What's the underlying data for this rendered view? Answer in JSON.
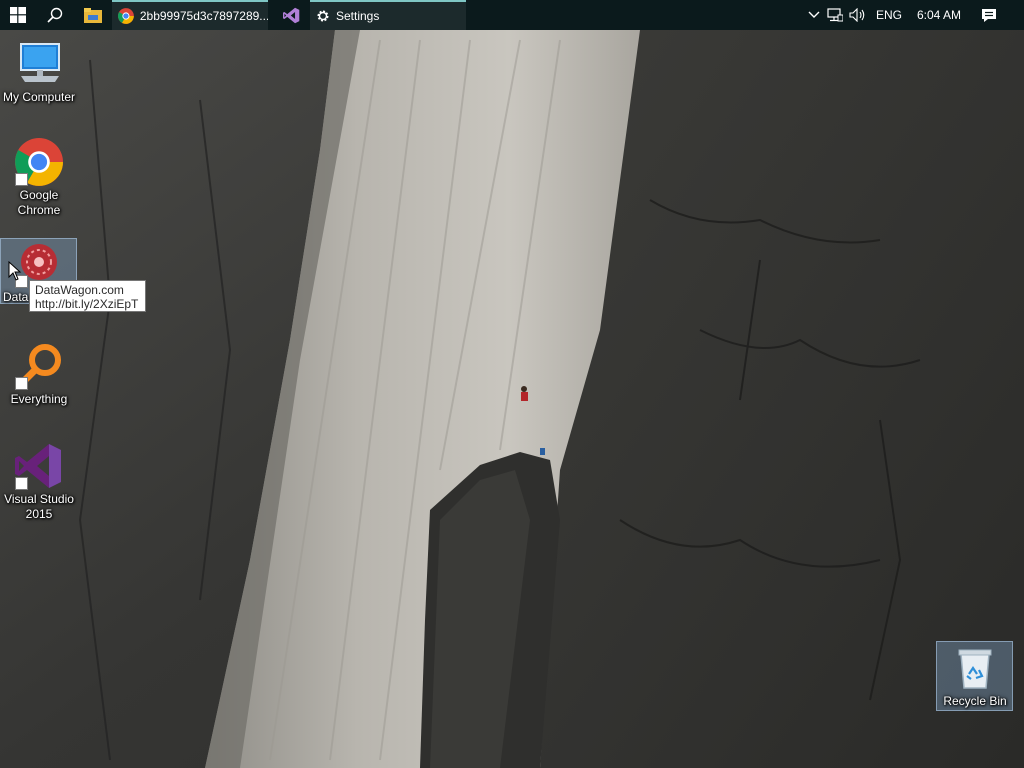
{
  "taskbar": {
    "start_icon": "windows-logo-icon",
    "search_icon": "search-icon",
    "explorer_icon": "file-explorer-icon",
    "apps": [
      {
        "icon": "chrome-icon",
        "label": "2bb99975d3c7897289..."
      },
      {
        "icon": "visual-studio-icon",
        "label": ""
      },
      {
        "icon": "gear-icon",
        "label": "Settings"
      }
    ],
    "tray": {
      "chevron_icon": "chevron-up-icon",
      "network_icon": "network-icon",
      "volume_icon": "volume-icon",
      "language": "ENG",
      "time": "6:04 AM",
      "notifications_icon": "action-center-icon"
    }
  },
  "desktop": {
    "icons": [
      {
        "label": "My Computer",
        "icon": "computer-icon"
      },
      {
        "label": "Google Chrome",
        "icon": "chrome-icon"
      },
      {
        "label": "Data",
        "icon": "datawagon-icon"
      },
      {
        "label": "Everything",
        "icon": "everything-search-icon"
      },
      {
        "label": "Visual Studio 2015",
        "icon": "visual-studio-icon"
      },
      {
        "label": "Recycle Bin",
        "icon": "recycle-bin-icon"
      }
    ]
  },
  "tooltip": {
    "line1": "DataWagon.com",
    "line2": "http://bit.ly/2XziEpT"
  },
  "colors": {
    "taskbar_bg": "#0b1a1c",
    "taskbar_accent": "#7fc6c4",
    "visual_studio": "#68217a"
  }
}
